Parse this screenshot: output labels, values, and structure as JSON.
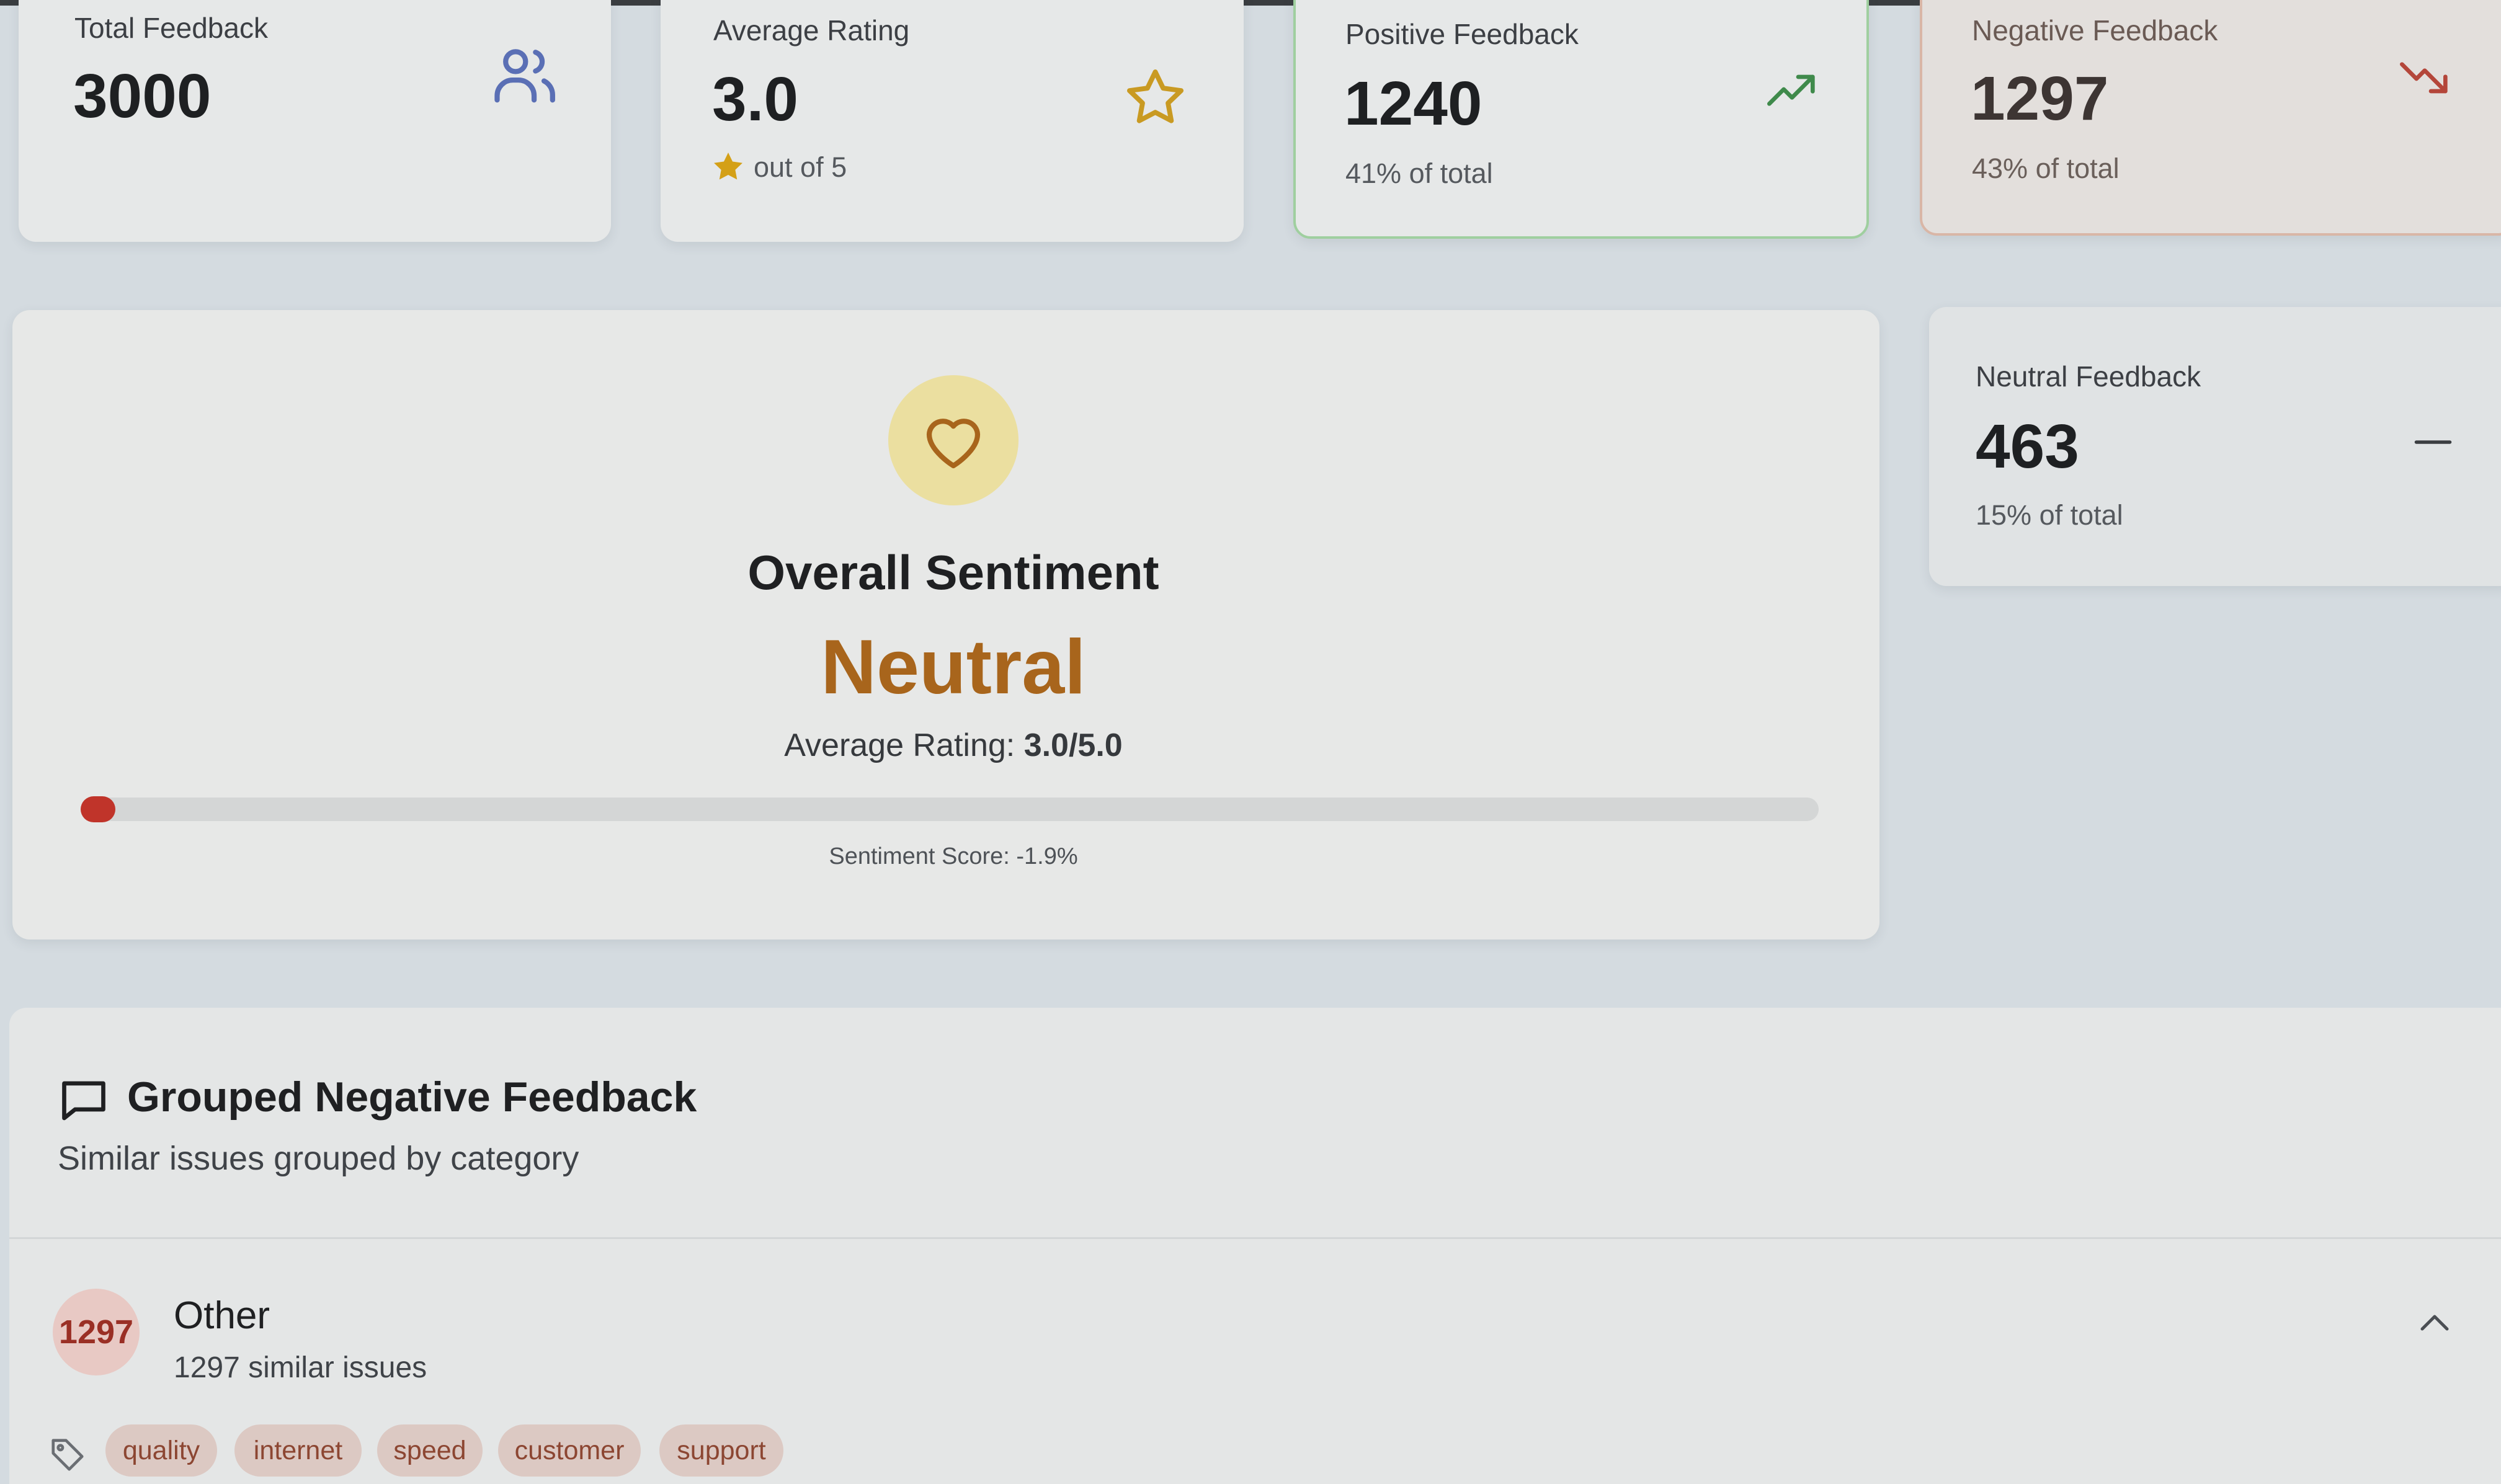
{
  "stats": {
    "total": {
      "label": "Total Feedback",
      "value": "3000",
      "icon": "users-icon"
    },
    "rating": {
      "label": "Average Rating",
      "value": "3.0",
      "sub": "out of 5",
      "icon": "star-icon"
    },
    "positive": {
      "label": "Positive Feedback",
      "value": "1240",
      "sub": "41% of total",
      "icon": "trending-up-icon"
    },
    "negative": {
      "label": "Negative Feedback",
      "value": "1297",
      "sub": "43% of total",
      "icon": "trending-down-icon"
    },
    "neutral": {
      "label": "Neutral Feedback",
      "value": "463",
      "sub": "15% of total",
      "icon": "minus-icon"
    }
  },
  "sentiment": {
    "title": "Overall Sentiment",
    "value": "Neutral",
    "rating_prefix": "Average Rating: ",
    "rating_value": "3.0/5.0",
    "score_text": "Sentiment Score: -1.9%",
    "score": -1.9,
    "icon": "heart-icon"
  },
  "grouped": {
    "title": "Grouped Negative Feedback",
    "subtitle": "Similar issues grouped by category",
    "icon": "message-square-icon",
    "groups": [
      {
        "count": "1297",
        "name": "Other",
        "detail": "1297 similar issues",
        "tags": [
          "quality",
          "internet",
          "speed",
          "customer",
          "support"
        ]
      }
    ]
  },
  "colors": {
    "accent_neutral": "#a8651c",
    "positive_border": "#9fcf9f",
    "negative_border": "#d9b6a6",
    "progress_dot": "#c0342a",
    "badge_bg": "#e8c9c4",
    "badge_text": "#9a2f25",
    "tag_bg": "#dcc9c3",
    "tag_text": "#8c4632"
  }
}
